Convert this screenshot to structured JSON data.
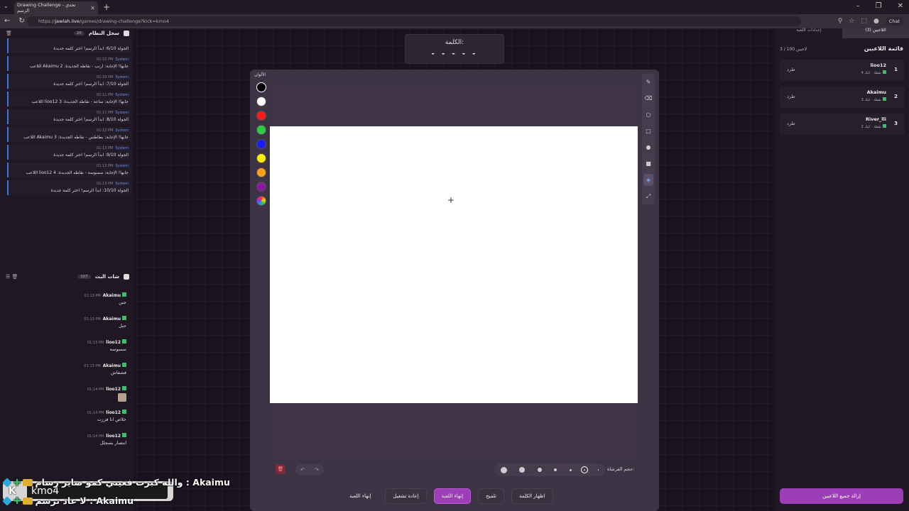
{
  "browser": {
    "tab_title": "Drawing Challenge - تحدي الرسم",
    "url_prefix": "https://",
    "url_host": "jawlah.live",
    "url_path": "/games/drawing-challenge?kick=kmo4",
    "chat_label": "Chat"
  },
  "word": {
    "label": "الكلمة:",
    "blanks": "- - - - -"
  },
  "system_log": {
    "title": "سجل النظام",
    "count": "26",
    "entries": [
      {
        "sender": "",
        "time": "",
        "text": "الجولة 6/10: ابدأ الرسم! اختر كلمة جديدة"
      },
      {
        "sender": "System",
        "time": "01:10 PM",
        "text": "اللاعب Akaimu جابها! الإجابة: ارنب - نقاطه الجديدة: 2"
      },
      {
        "sender": "System",
        "time": "01:10 PM",
        "text": "الجولة 7/10: ابدأ الرسم! اختر كلمة جديدة"
      },
      {
        "sender": "System",
        "time": "01:11 PM",
        "text": "اللاعب lioo12 جابها! الإجابة: ساعة - نقاطه الجديدة: 3"
      },
      {
        "sender": "System",
        "time": "01:11 PM",
        "text": "الجولة 8/10: ابدأ الرسم! اختر كلمة جديدة"
      },
      {
        "sender": "System",
        "time": "01:12 PM",
        "text": "اللاعب Akaimu جابها! الإجابة: بطاطس - نقاطه الجديدة: 3"
      },
      {
        "sender": "System",
        "time": "01:13 PM",
        "text": "الجولة 9/10: ابدأ الرسم! اختر كلمة جديدة"
      },
      {
        "sender": "System",
        "time": "01:13 PM",
        "text": "اللاعب lioo12 جابها! الإجابة: سمبوسة - نقاطه الجديدة: 4"
      },
      {
        "sender": "System",
        "time": "01:13 PM",
        "text": "الجولة 10/10: ابدأ الرسم! اختر كلمة جديدة"
      }
    ]
  },
  "live_chat": {
    "title": "شات البث",
    "count": "107",
    "messages": [
      {
        "user": "Akaimu",
        "time": "01:13 PM",
        "text": "جبن"
      },
      {
        "user": "Akaimu",
        "time": "01:13 PM",
        "text": "جبل"
      },
      {
        "user": "lioo12",
        "time": "01:13 PM",
        "text": "سمبوسه"
      },
      {
        "user": "Akaimu",
        "time": "01:13 PM",
        "text": "فشفاش"
      },
      {
        "user": "lioo12",
        "time": "01:14 PM",
        "text": ""
      },
      {
        "user": "lioo12",
        "time": "01:14 PM",
        "text": "خلاص انا فززت"
      },
      {
        "user": "lioo12",
        "time": "01:14 PM",
        "text": "انتصار بسجلل"
      }
    ]
  },
  "canvas": {
    "colors_label": "الألوان",
    "colors": [
      "#000000",
      "#ffffff",
      "#ff1a1a",
      "#2ecc40",
      "#1a1aff",
      "#ffee00",
      "#ff9f1a",
      "#8a1aa0"
    ],
    "brush_size_label": "حجم الفرشاة:"
  },
  "actions": {
    "end_game_plain": "إنهاء اللعبة",
    "restart": "إعادة تشغيل",
    "end_game": "إنهاء اللعبة",
    "hint": "تلميح",
    "reveal_word": "اظهار الكلمة"
  },
  "players_panel": {
    "tab_players": "اللاعبين (3)",
    "tab_settings": "إعدادات اللعبة",
    "title": "قائمة اللاعبين",
    "count": "3 / 100 لاعبين",
    "kick_label": "طرد",
    "players": [
      {
        "rank": "1",
        "name": "lioo12",
        "points": "4 نقطة · كيك"
      },
      {
        "rank": "2",
        "name": "Akaimu",
        "points": "3 نقطة · كيك"
      },
      {
        "rank": "3",
        "name": "River_lli",
        "points": "2 نقطة · كيك"
      }
    ],
    "remove_all": "إزالة جميع اللاعبين"
  },
  "overlay": {
    "streamer": "kmo4",
    "line1": "والله كبرت فعيني كمو صاير رسام : Akaimu",
    "line2": "لا عاد ترسم : Akaimu"
  }
}
